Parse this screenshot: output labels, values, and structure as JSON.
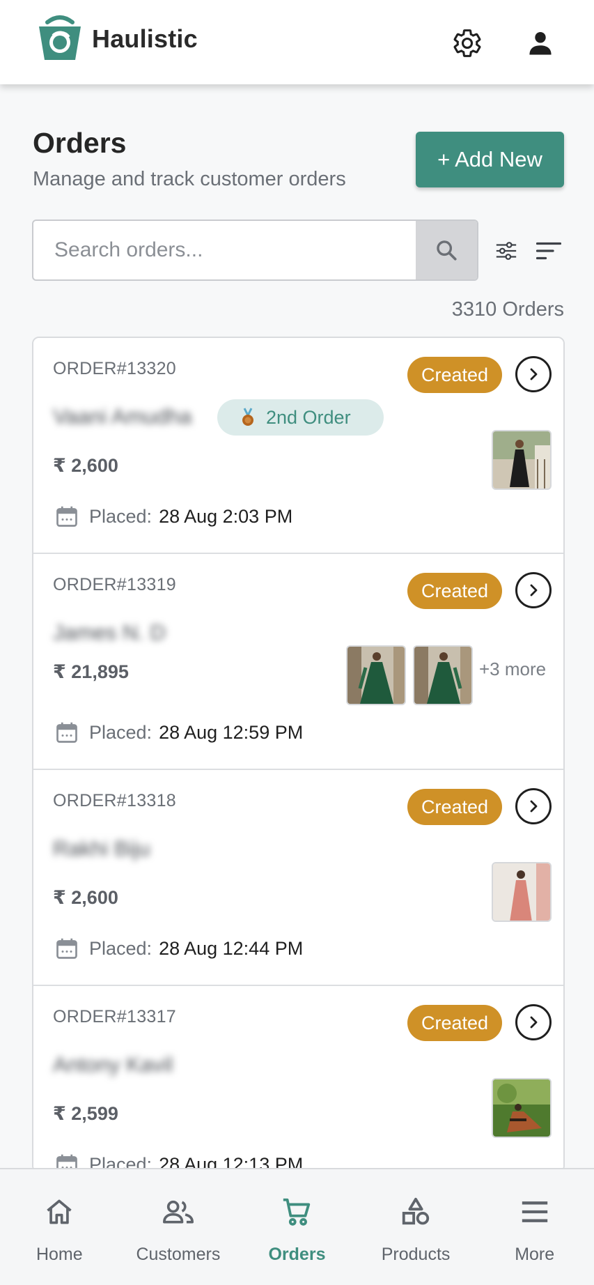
{
  "app": {
    "brand_name": "Haulistic",
    "accent": "#3f8e7f",
    "status_color": "#cf9127"
  },
  "header": {
    "settings_icon": "gear-icon",
    "profile_icon": "user-icon"
  },
  "page": {
    "title": "Orders",
    "subtitle": "Manage and track customer orders",
    "add_new_label": "+ Add New"
  },
  "search": {
    "placeholder": "Search orders...",
    "value": ""
  },
  "summary": {
    "count_label": "3310 Orders"
  },
  "orders": [
    {
      "id": "ORDER#13320",
      "status": "Created",
      "customer": "Vaani Amudha",
      "badge": "2nd Order",
      "amount": "₹ 2,600",
      "placed_label": "Placed:",
      "placed_at": "28 Aug 2:03 PM"
    },
    {
      "id": "ORDER#13319",
      "status": "Created",
      "customer": "James N. D",
      "amount": "₹ 21,895",
      "more": "+3 more",
      "placed_label": "Placed:",
      "placed_at": "28 Aug 12:59 PM"
    },
    {
      "id": "ORDER#13318",
      "status": "Created",
      "customer": "Rakhi Biju",
      "amount": "₹ 2,600",
      "placed_label": "Placed:",
      "placed_at": "28 Aug 12:44 PM"
    },
    {
      "id": "ORDER#13317",
      "status": "Created",
      "customer": "Antony Kavil",
      "amount": "₹ 2,599",
      "placed_label": "Placed:",
      "placed_at": "28 Aug 12:13 PM"
    }
  ],
  "nav": {
    "items": [
      {
        "label": "Home",
        "icon": "home-icon"
      },
      {
        "label": "Customers",
        "icon": "customers-icon"
      },
      {
        "label": "Orders",
        "icon": "cart-icon",
        "active": true
      },
      {
        "label": "Products",
        "icon": "shapes-icon"
      },
      {
        "label": "More",
        "icon": "menu-icon"
      }
    ]
  }
}
